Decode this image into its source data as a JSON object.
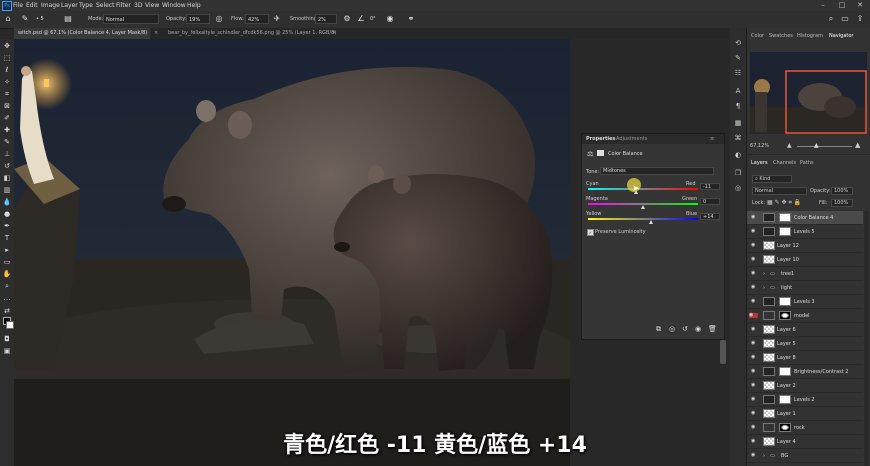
{
  "menubar": {
    "items": [
      "File",
      "Edit",
      "Image",
      "Layer",
      "Type",
      "Select",
      "Filter",
      "3D",
      "View",
      "Window",
      "Help"
    ],
    "logo": "Ps"
  },
  "options": {
    "mode_label": "Mode:",
    "mode_value": "Normal",
    "opacity_label": "Opacity:",
    "opacity_value": "19%",
    "flow_label": "Flow:",
    "flow_value": "42%",
    "smoothing_label": "Smoothing:",
    "smoothing_value": "2%",
    "angle_value": "0°",
    "brush_size": "5"
  },
  "tabs": [
    {
      "label": "witch.psd @ 67,1% (Color Balance 4, Layer Mask/8) *",
      "active": true
    },
    {
      "label": "bear_by_felixaltyle_schindler_dfcdk56.png @ 25% (Layer 1, RGB/8)",
      "active": false
    }
  ],
  "right_panel": {
    "tabs": [
      "Color",
      "Swatches",
      "Histogram",
      "Navigator"
    ],
    "zoom": "67,12%"
  },
  "properties": {
    "tabs": [
      "Properties",
      "Adjustments"
    ],
    "adjustment": "Color Balance",
    "tone_label": "Tone:",
    "tone_value": "Midtones",
    "sliders": [
      {
        "left": "Cyan",
        "right": "Red",
        "value": "-11",
        "position": 0.44
      },
      {
        "left": "Magenta",
        "right": "Green",
        "value": "0",
        "position": 0.5
      },
      {
        "left": "Yellow",
        "right": "Blue",
        "value": "+14",
        "position": 0.57
      }
    ],
    "preserve": "Preserve Luminosity"
  },
  "layers_panel": {
    "tabs": [
      "Layers",
      "Channels",
      "Paths"
    ],
    "kind": "Kind",
    "blend": "Normal",
    "opacity_label": "Opacity:",
    "opacity": "100%",
    "lock_label": "Lock:",
    "fill_label": "Fill:",
    "fill": "100%",
    "layers": [
      {
        "name": "Color Balance 4",
        "type": "adjust",
        "selected": true
      },
      {
        "name": "Levels 5",
        "type": "adjust"
      },
      {
        "name": "Layer 12",
        "type": "pixel"
      },
      {
        "name": "Layer 10",
        "type": "pixel"
      },
      {
        "name": "tree1",
        "type": "group"
      },
      {
        "name": "light",
        "type": "group"
      },
      {
        "name": "Levels 3",
        "type": "adjust"
      },
      {
        "name": "model",
        "type": "mask"
      },
      {
        "name": "Layer 6",
        "type": "pixel"
      },
      {
        "name": "Layer 5",
        "type": "pixel"
      },
      {
        "name": "Layer 8",
        "type": "pixel"
      },
      {
        "name": "Brightness/Contrast 2",
        "type": "adjust"
      },
      {
        "name": "Layer 2",
        "type": "pixel"
      },
      {
        "name": "Levels 2",
        "type": "adjust"
      },
      {
        "name": "Layer 1",
        "type": "pixel"
      },
      {
        "name": "rock",
        "type": "mask"
      },
      {
        "name": "Layer 4",
        "type": "pixel"
      },
      {
        "name": "BG",
        "type": "group"
      }
    ]
  },
  "subtitle": "青色/红色 -11 黄色/蓝色 +14"
}
